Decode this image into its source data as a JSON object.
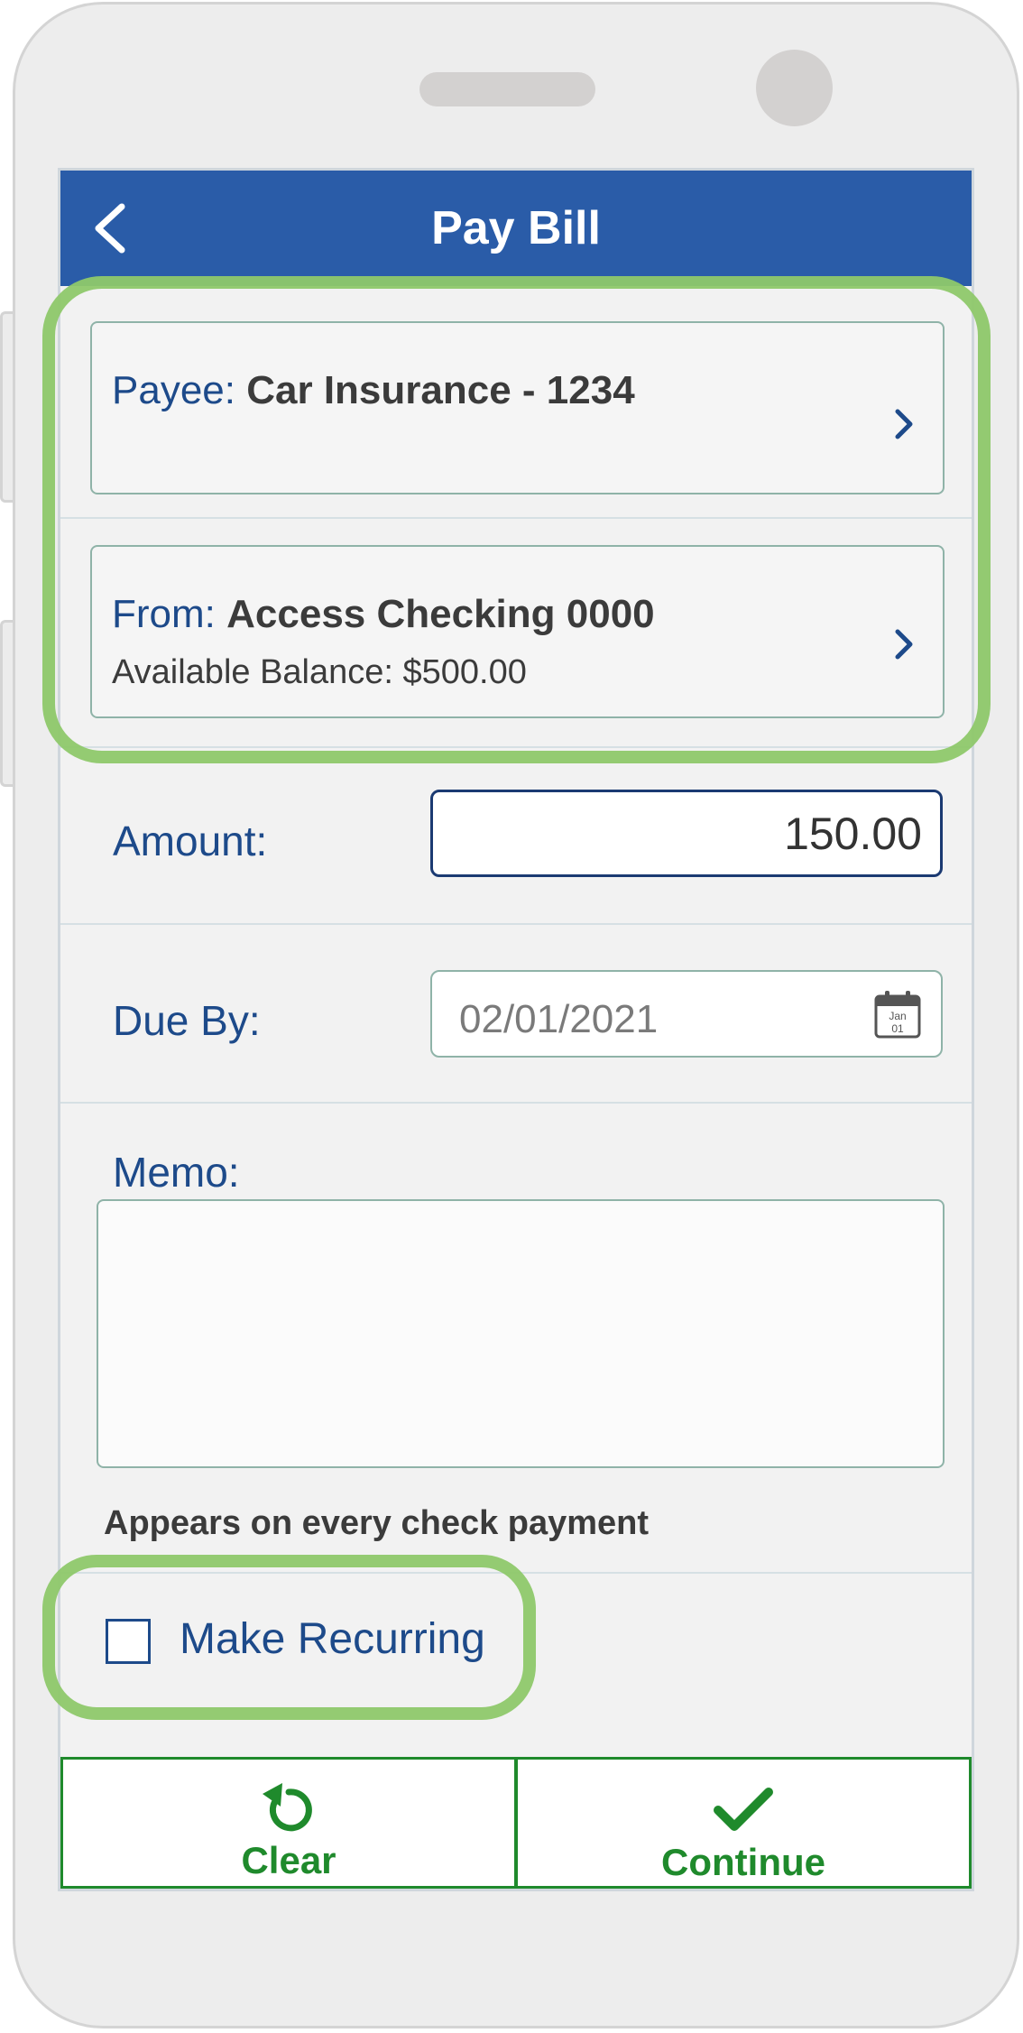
{
  "header": {
    "title": "Pay Bill",
    "back_icon": "chevron-left-icon"
  },
  "payee": {
    "label": "Payee:",
    "value": "Car Insurance - 1234",
    "chevron_icon": "chevron-right-icon"
  },
  "from": {
    "label": "From:",
    "value": "Access Checking 0000",
    "balance": "Available Balance: $500.00",
    "chevron_icon": "chevron-right-icon"
  },
  "amount": {
    "label": "Amount:",
    "value": "150.00"
  },
  "due_by": {
    "label": "Due By:",
    "value": "02/01/2021",
    "calendar_month": "Jan",
    "calendar_day": "01"
  },
  "memo": {
    "label": "Memo:",
    "value": "",
    "help_text": "Appears on every check payment"
  },
  "recurring": {
    "label": "Make Recurring",
    "checked": false
  },
  "actions": {
    "clear_label": "Clear",
    "continue_label": "Continue"
  },
  "colors": {
    "header": "#2a5ca8",
    "label_blue": "#1d4a8a",
    "action_green": "#1f8a2c",
    "highlight_green": "#8ec86a"
  }
}
